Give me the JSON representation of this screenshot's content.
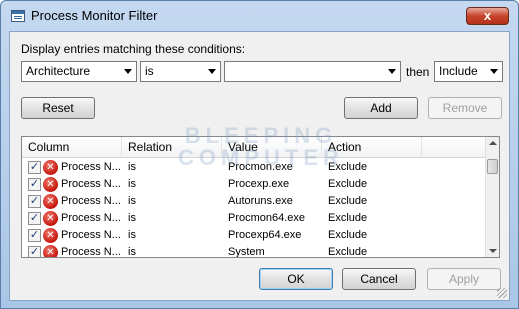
{
  "window": {
    "title": "Process Monitor Filter",
    "close_glyph": "x"
  },
  "prompt": "Display entries matching these conditions:",
  "condition": {
    "column": "Architecture",
    "relation": "is",
    "value": "",
    "then_label": "then",
    "action": "Include"
  },
  "buttons": {
    "reset": "Reset",
    "add": "Add",
    "remove": "Remove",
    "ok": "OK",
    "cancel": "Cancel",
    "apply": "Apply"
  },
  "table": {
    "headers": [
      "Column",
      "Relation",
      "Value",
      "Action"
    ],
    "rows": [
      {
        "column": "Process N...",
        "relation": "is",
        "value": "Procmon.exe",
        "action": "Exclude",
        "checked": true
      },
      {
        "column": "Process N...",
        "relation": "is",
        "value": "Procexp.exe",
        "action": "Exclude",
        "checked": true
      },
      {
        "column": "Process N...",
        "relation": "is",
        "value": "Autoruns.exe",
        "action": "Exclude",
        "checked": true
      },
      {
        "column": "Process N...",
        "relation": "is",
        "value": "Procmon64.exe",
        "action": "Exclude",
        "checked": true
      },
      {
        "column": "Process N...",
        "relation": "is",
        "value": "Procexp64.exe",
        "action": "Exclude",
        "checked": true
      },
      {
        "column": "Process N...",
        "relation": "is",
        "value": "System",
        "action": "Exclude",
        "checked": true
      }
    ]
  },
  "watermark": {
    "line1": "BLEEPING",
    "line2": "COMPUTER"
  },
  "icons": {
    "check": "checkbox-checked-icon",
    "exclude": "red-x-circle-icon"
  }
}
